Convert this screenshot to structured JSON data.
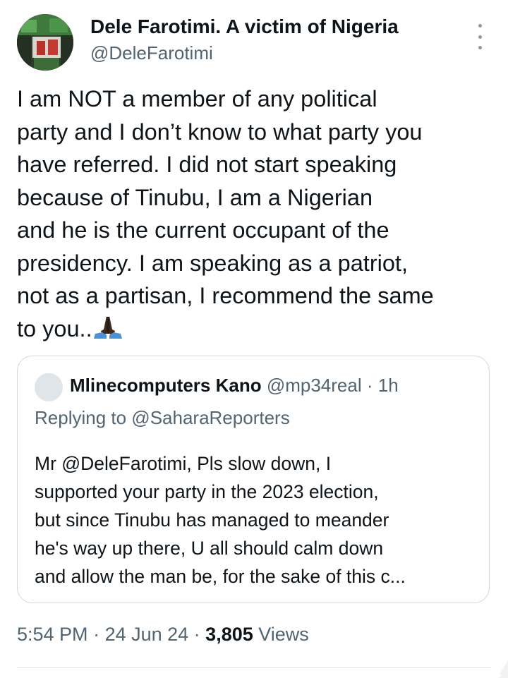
{
  "tweet": {
    "author_name": "Dele Farotimi. A victim of Nigeria",
    "author_handle": "@DeleFarotimi",
    "more_icon": "vertical-ellipsis-icon",
    "text": "I am NOT a member of any political\nparty and I don’t know to what party you\nhave referred. I did not start speaking\nbecause of Tinubu, I am a Nigerian\nand he is the current occupant of the\npresidency. I am speaking as a patriot,\nnot as a partisan, I recommend the same\nto you..",
    "emoji": "folded-hands-icon"
  },
  "quote": {
    "author_name": "Mlinecomputers Kano",
    "author_handle": "@mp34real",
    "separator": " · ",
    "time": "1h",
    "replying_to": "Replying to @SaharaReporters",
    "text": "Mr @DeleFarotimi, Pls slow down, I\nsupported your party in the 2023 election,\nbut since Tinubu has managed to meander\nhe's way up there, U all should calm down\nand allow the man be, for the sake of this c..."
  },
  "footer": {
    "time": "5:54 PM",
    "separator": " · ",
    "date": "24 Jun 24",
    "views_count": "3,805",
    "views_label": " Views"
  },
  "colors": {
    "text": "#0f1419",
    "secondary": "#536471",
    "border": "#cfd9de"
  }
}
